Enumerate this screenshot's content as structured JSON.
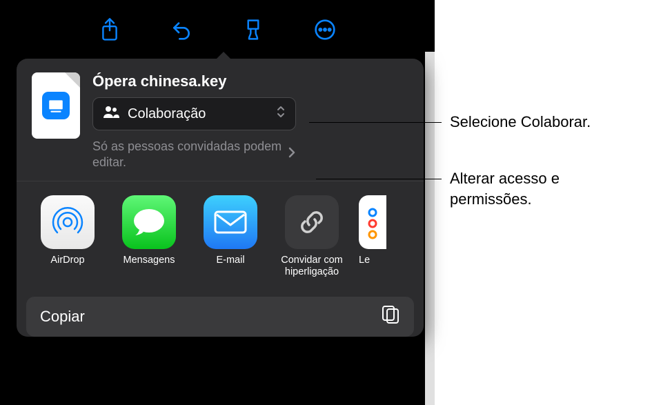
{
  "document": {
    "filename": "Ópera chinesa.key"
  },
  "share_mode": {
    "label": "Colaboração"
  },
  "permissions": {
    "summary": "Só as pessoas convidadas podem editar."
  },
  "apps": [
    {
      "name": "AirDrop"
    },
    {
      "name": "Mensagens"
    },
    {
      "name": "E-mail"
    },
    {
      "name": "Convidar com hiperligação"
    },
    {
      "name": "Lembretes"
    }
  ],
  "actions": {
    "copy": "Copiar"
  },
  "annotations": {
    "select_collaborate": "Selecione Colaborar.",
    "change_access": "Alterar acesso e permissões."
  }
}
